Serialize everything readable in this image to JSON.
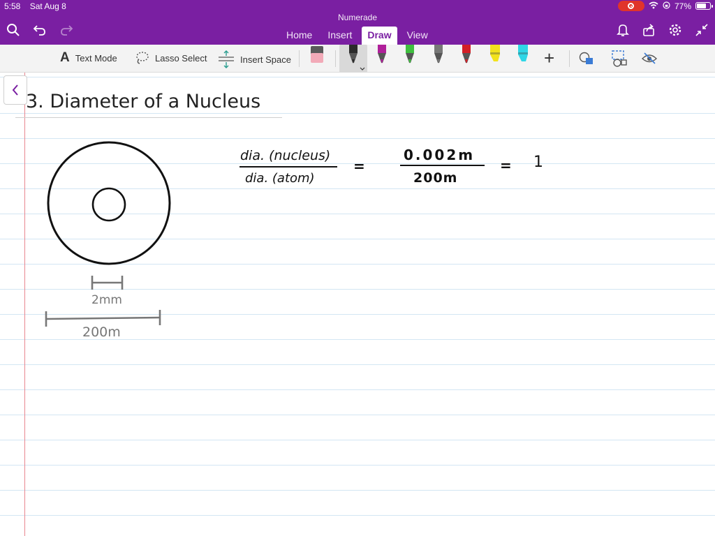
{
  "status": {
    "time": "5:58",
    "date": "Sat Aug 8",
    "battery": "77%",
    "battery_level": 0.77
  },
  "app": {
    "title": "Numerade"
  },
  "tabs": [
    {
      "label": "Home",
      "active": false
    },
    {
      "label": "Insert",
      "active": false
    },
    {
      "label": "Draw",
      "active": true
    },
    {
      "label": "View",
      "active": false
    }
  ],
  "toolbar": {
    "text_mode_label": "Text Mode",
    "lasso_label": "Lasso Select",
    "insert_space_label": "Insert Space",
    "pens": [
      {
        "name": "pen-black",
        "color": "#2b2b2b",
        "selected": true
      },
      {
        "name": "pen-magenta",
        "color": "#b0209a"
      },
      {
        "name": "pen-green",
        "color": "#3fbf3f"
      },
      {
        "name": "pen-gray",
        "color": "#777777"
      },
      {
        "name": "pen-red",
        "color": "#d21f26"
      },
      {
        "name": "highlighter-yellow",
        "color": "#f2e21c"
      },
      {
        "name": "highlighter-cyan",
        "color": "#2fd6e6"
      }
    ]
  },
  "page": {
    "title": "3. Diameter of a Nucleus",
    "drawing": {
      "small_label": "2mm",
      "large_label": "200m"
    },
    "equation": {
      "num1": "dia. (nucleus)",
      "den1": "dia. (atom)",
      "eq": "=",
      "num2": "0.002m",
      "den2": "200m",
      "eq2": "=",
      "result": "1"
    }
  },
  "colors": {
    "header": "#7a1fa2",
    "margin": "#e8868f",
    "rule": "#d3e6f3"
  }
}
